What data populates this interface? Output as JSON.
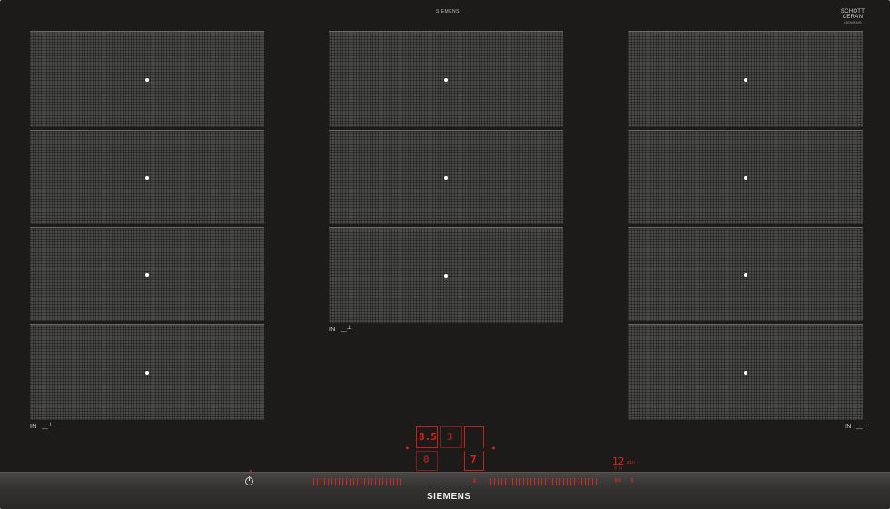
{
  "brand": {
    "top_text": "SIEMENS",
    "glass_maker": "SCHOTT",
    "glass_line": "CERAN",
    "glass_sub": "SIEMENS",
    "bottom_logo": "SIEMENS"
  },
  "zone_labels": {
    "left": "IN",
    "center": "IN",
    "right": "IN"
  },
  "control": {
    "display_level": "8.5",
    "display_zone": "3",
    "display_timer_a": "0",
    "display_timer_b": "7",
    "timer_value": "12",
    "timer_unit": "min",
    "timer_sub": "0:0"
  },
  "colors": {
    "glass": "#1d1b1a",
    "zone": "#4a4948",
    "indicator": "#e2231a",
    "strip": "#343230"
  },
  "icons": {
    "power": "power-icon",
    "induction": "induction-pan-icon"
  }
}
